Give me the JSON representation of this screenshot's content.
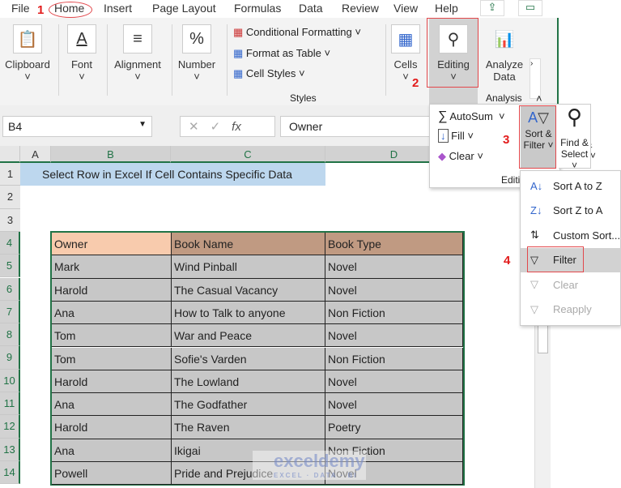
{
  "ribbon_tabs": [
    "File",
    "Home",
    "Insert",
    "Page Layout",
    "Formulas",
    "Data",
    "Review",
    "View",
    "Help"
  ],
  "groups": {
    "clipboard": "Clipboard",
    "font": "Font",
    "alignment": "Alignment",
    "number": "Number",
    "conditional_formatting": "Conditional Formatting",
    "format_as_table": "Format as Table",
    "cell_styles": "Cell Styles",
    "styles": "Styles",
    "cells": "Cells",
    "editing": "Editing",
    "analyze_line1": "Analyze",
    "analyze_line2": "Data",
    "analysis": "Analysis"
  },
  "formula_bar": {
    "name_box": "B4",
    "fx": "fx",
    "value": "Owner"
  },
  "editing_panel": {
    "autosum": "AutoSum",
    "fill": "Fill",
    "clear": "Clear",
    "group_label": "Editi",
    "sort_filter_1": "Sort &",
    "sort_filter_2": "Filter",
    "find_select_1": "Find &",
    "find_select_2": "Select"
  },
  "sort_menu": [
    {
      "label": "Sort A to Z",
      "enabled": true
    },
    {
      "label": "Sort Z to A",
      "enabled": true
    },
    {
      "label": "Custom Sort...",
      "enabled": true
    },
    {
      "label": "Filter",
      "enabled": true,
      "highlighted": true
    },
    {
      "label": "Clear",
      "enabled": false
    },
    {
      "label": "Reapply",
      "enabled": false
    }
  ],
  "steps": [
    "1",
    "2",
    "3",
    "4"
  ],
  "columns": [
    "A",
    "B",
    "C",
    "D"
  ],
  "rows": [
    "1",
    "2",
    "3",
    "4",
    "5",
    "6",
    "7",
    "8",
    "9",
    "10",
    "11",
    "12",
    "13",
    "14"
  ],
  "title_cell": "Select Row in Excel If Cell Contains Specific Data",
  "table": {
    "headers": [
      "Owner",
      "Book Name",
      "Book Type"
    ],
    "rows": [
      [
        "Mark",
        "Wind Pinball",
        "Novel"
      ],
      [
        "Harold",
        "The Casual Vacancy",
        "Novel"
      ],
      [
        "Ana",
        "How to Talk to anyone",
        "Non Fiction"
      ],
      [
        "Tom",
        "War and Peace",
        "Novel"
      ],
      [
        "Tom",
        "Sofie's Varden",
        "Non Fiction"
      ],
      [
        "Harold",
        "The Lowland",
        "Novel"
      ],
      [
        "Ana",
        "The Godfather",
        "Novel"
      ],
      [
        "Harold",
        "The Raven",
        "Poetry"
      ],
      [
        "Ana",
        "Ikigai",
        "Non Fiction"
      ],
      [
        "Powell",
        "Pride and Prejudice",
        "Novel"
      ]
    ]
  },
  "watermark": "exceldemy",
  "colors": {
    "accent": "#217346",
    "annotation": "#e21b1b",
    "header_owner": "#f8cbad",
    "header_other": "#c09a82",
    "title_bg": "#bdd7ee",
    "body_cells": "#c7c7c7"
  }
}
